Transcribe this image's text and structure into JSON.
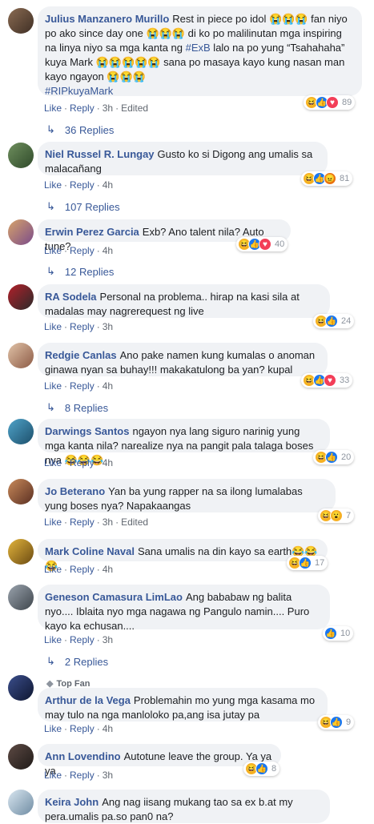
{
  "labels": {
    "like": "Like",
    "reply": "Reply",
    "edited": "Edited",
    "top_fan": "Top Fan"
  },
  "comments": [
    {
      "name": "Julius Manzanero Murillo",
      "time": "3h",
      "edited": true,
      "react_count": "89",
      "replies": "36 Replies",
      "text_a": "Rest in piece po idol ",
      "emo_a": "😭😭😭",
      "text_b": " fan niyo po ako since day one ",
      "emo_b": "😭😭😭",
      "text_c": " di ko po malilinutan mga inspiring na linya niyo sa mga kanta ng ",
      "tag_a": "#ExB",
      "text_d": " lalo na po yung “Tsahahaha” kuya Mark ",
      "emo_c": "😭😭😭😭😭",
      "text_e": " sana po masaya kayo kung nasan man kayo ngayon ",
      "emo_d": "😭😭😭",
      "tag_b": "#RIPkuyaMark"
    },
    {
      "name": "Niel Russel R. Lungay",
      "text": "Gusto ko si Digong ang umalis sa malacañang",
      "time": "4h",
      "react_count": "81",
      "replies": "107 Replies"
    },
    {
      "name": "Erwin Perez Garcia",
      "text": "Exb? Ano talent nila? Auto tune?",
      "time": "4h",
      "react_count": "40",
      "replies": "12 Replies"
    },
    {
      "name": "RA Sodela",
      "text": "Personal na problema.. hirap na kasi sila at madalas may nagrerequest ng live",
      "time": "3h",
      "react_count": "24"
    },
    {
      "name": "Redgie Canlas",
      "text": "Ano pake namen kung kumalas o anoman ginawa nyan sa buhay!!! makakatulong ba yan? kupal",
      "time": "4h",
      "react_count": "33",
      "replies": "8 Replies"
    },
    {
      "name": "Darwings Santos",
      "text": "ngayon nya lang siguro narinig yung mga kanta nila? narealize nya na pangit pala talaga boses nya ",
      "emo": "😂😂😂",
      "time": "4h",
      "react_count": "20"
    },
    {
      "name": "Jo Beterano",
      "text": "Yan ba yung rapper na sa ilong lumalabas yung boses nya? Napakaangas",
      "time": "3h",
      "edited": true,
      "react_count": "7"
    },
    {
      "name": "Mark Coline Naval",
      "text": "Sana umalis na din kayo sa earth",
      "emo": "😂😂😂",
      "time": "4h",
      "react_count": "17"
    },
    {
      "name": "Geneson Camasura LimLao",
      "text": "Ang bababaw ng balita nyo.... Iblaita nyo mga nagawa ng Pangulo namin.... Puro kayo ka echusan....",
      "time": "3h",
      "react_count": "10",
      "replies": "2 Replies"
    },
    {
      "name": "Arthur de la Vega",
      "text": "Problemahin mo yung mga kasama mo may tulo na nga manloloko pa,ang isa jutay pa",
      "time": "4h",
      "react_count": "9"
    },
    {
      "name": "Ann Lovendino",
      "text": "Autotune leave the group. Ya ya ya",
      "time": "3h",
      "react_count": "8"
    },
    {
      "name": "Keira John",
      "text": "Ang nag iisang mukang tao sa ex b.at my pera.umalis pa.so pan0 na?"
    }
  ]
}
